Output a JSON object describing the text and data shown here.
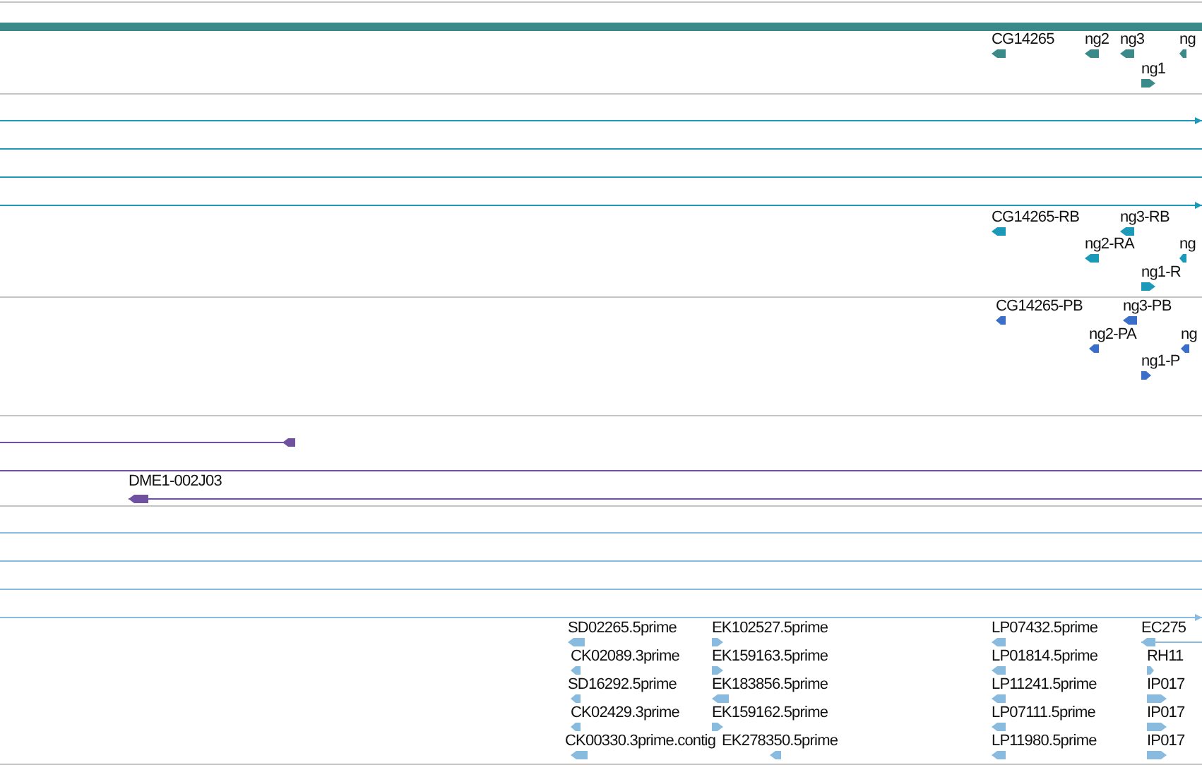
{
  "tracks": [
    {
      "kind": "genes",
      "color": "#3a8a8a",
      "features": [
        {
          "label": "CG14265",
          "reverse_strand": true
        },
        {
          "label": "ng2",
          "reverse_strand": true
        },
        {
          "label": "ng3",
          "reverse_strand": true
        },
        {
          "label": "ng",
          "reverse_strand": true
        },
        {
          "label": "ng1",
          "reverse_strand": false
        }
      ]
    },
    {
      "kind": "transcripts",
      "color": "#1a9ab8",
      "features": [
        {
          "label": "CG14265-RB",
          "reverse_strand": true
        },
        {
          "label": "ng3-RB",
          "reverse_strand": true
        },
        {
          "label": "ng2-RA",
          "reverse_strand": true
        },
        {
          "label": "ng",
          "reverse_strand": true
        },
        {
          "label": "ng1-R",
          "reverse_strand": false
        }
      ]
    },
    {
      "kind": "proteins",
      "color": "#3a6ec8",
      "features": [
        {
          "label": "CG14265-PB",
          "reverse_strand": true
        },
        {
          "label": "ng3-PB",
          "reverse_strand": true
        },
        {
          "label": "ng2-PA",
          "reverse_strand": true
        },
        {
          "label": "ng",
          "reverse_strand": true
        },
        {
          "label": "ng1-P",
          "reverse_strand": false
        }
      ]
    },
    {
      "kind": "clones",
      "color": "#7050a0",
      "features": [
        {
          "label": "DME1-002J03",
          "reverse_strand": true
        }
      ]
    },
    {
      "kind": "ests",
      "color": "#88bbdd",
      "features": [
        {
          "label": "SD02265.5prime",
          "reverse_strand": true
        },
        {
          "label": "EK102527.5prime",
          "reverse_strand": false
        },
        {
          "label": "LP07432.5prime",
          "reverse_strand": true
        },
        {
          "label": "EC275",
          "reverse_strand": true
        },
        {
          "label": "CK02089.3prime",
          "reverse_strand": true
        },
        {
          "label": "EK159163.5prime",
          "reverse_strand": false
        },
        {
          "label": "LP01814.5prime",
          "reverse_strand": true
        },
        {
          "label": "RH11",
          "reverse_strand": false
        },
        {
          "label": "SD16292.5prime",
          "reverse_strand": true
        },
        {
          "label": "EK183856.5prime",
          "reverse_strand": true
        },
        {
          "label": "LP11241.5prime",
          "reverse_strand": true
        },
        {
          "label": "IP017",
          "reverse_strand": false
        },
        {
          "label": "CK02429.3prime",
          "reverse_strand": true
        },
        {
          "label": "EK159162.5prime",
          "reverse_strand": false
        },
        {
          "label": "LP07111.5prime",
          "reverse_strand": true
        },
        {
          "label": "IP017",
          "reverse_strand": false
        },
        {
          "label": "CK00330.3prime.contig",
          "reverse_strand": true
        },
        {
          "label": "EK278350.5prime",
          "reverse_strand": true
        },
        {
          "label": "LP11980.5prime",
          "reverse_strand": true
        },
        {
          "label": "IP017",
          "reverse_strand": false
        }
      ]
    }
  ]
}
